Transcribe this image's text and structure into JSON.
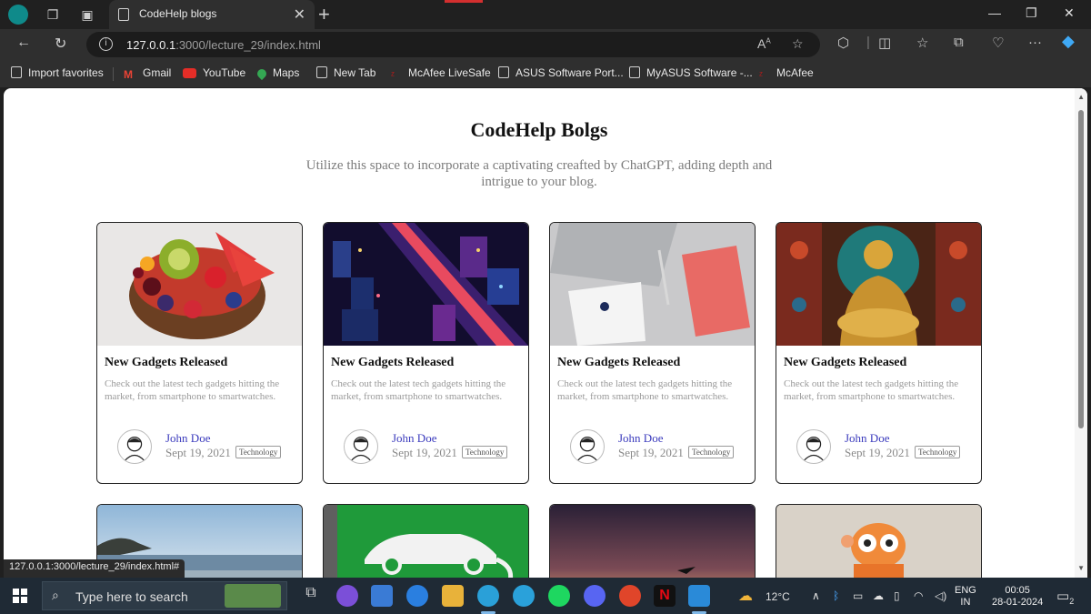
{
  "browser": {
    "tab_title": "CodeHelp blogs",
    "url_host": "127.0.0.1",
    "url_path": ":3000/lecture_29/index.html",
    "status_url": "127.0.0.1:3000/lecture_29/index.html#"
  },
  "bookmarks": [
    {
      "label": "Import favorites",
      "icon": "folder-icon"
    },
    {
      "label": "Gmail",
      "icon": "gmail-icon"
    },
    {
      "label": "YouTube",
      "icon": "youtube-icon"
    },
    {
      "label": "Maps",
      "icon": "maps-icon"
    },
    {
      "label": "New Tab",
      "icon": "page-icon"
    },
    {
      "label": "McAfee LiveSafe",
      "icon": "mcafee-icon"
    },
    {
      "label": "ASUS Software Port...",
      "icon": "page-icon"
    },
    {
      "label": "MyASUS Software -...",
      "icon": "page-icon"
    },
    {
      "label": "McAfee",
      "icon": "mcafee-icon"
    }
  ],
  "page": {
    "title": "CodeHelp Bolgs",
    "subtitle": "Utilize this space to incorporate a captivating creafted by ChatGPT, adding depth and intrigue to your blog."
  },
  "cards": [
    {
      "image": "fruit-bowl",
      "title": "New Gadgets Released",
      "desc": "Check out the latest tech gadgets hitting the market, from smartphone to smartwatches.",
      "author": "John Doe",
      "date": "Sept 19, 2021",
      "tag": "Technology"
    },
    {
      "image": "city-night",
      "title": "New Gadgets Released",
      "desc": "Check out the latest tech gadgets hitting the market, from smartphone to smartwatches.",
      "author": "John Doe",
      "date": "Sept 19, 2021",
      "tag": "Technology"
    },
    {
      "image": "laptop-notebook",
      "title": "New Gadgets Released",
      "desc": "Check out the latest tech gadgets hitting the market, from smartphone to smartwatches.",
      "author": "John Doe",
      "date": "Sept 19, 2021",
      "tag": "Technology"
    },
    {
      "image": "golden-buddha",
      "title": "New Gadgets Released",
      "desc": "Check out the latest tech gadgets hitting the market, from smartphone to smartwatches.",
      "author": "John Doe",
      "date": "Sept 19, 2021",
      "tag": "Technology"
    }
  ],
  "cards_row2": [
    "beach",
    "ev-charging",
    "sunset-plane",
    "cartoon-character"
  ],
  "taskbar": {
    "search_placeholder": "Type here to search",
    "temperature": "12°C",
    "language": "ENG",
    "region": "IN",
    "time": "00:05",
    "date": "28-01-2024",
    "notification_count": "2"
  },
  "colors": {
    "accent_author": "#3b3bbd",
    "browser_bg": "#202020",
    "taskbar_bg": "#1f2a35"
  }
}
